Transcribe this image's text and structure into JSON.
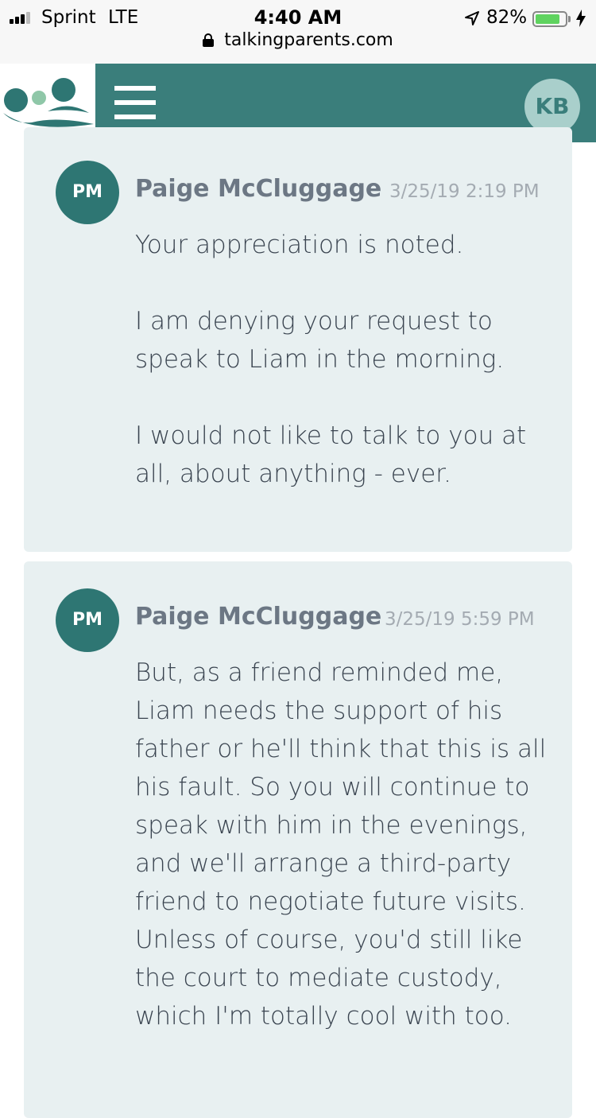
{
  "status_bar": {
    "carrier": "Sprint",
    "network": "LTE",
    "time": "4:40 AM",
    "battery_percent": "82%",
    "battery_level": 0.82,
    "url": "talkingparents.com"
  },
  "header": {
    "user_initials": "KB",
    "logo_icon": "talkingparents-logo",
    "menu_icon": "hamburger-menu-icon"
  },
  "messages": [
    {
      "initials": "PM",
      "sender": "Paige McCluggage",
      "timestamp": "3/25/19 2:19 PM",
      "body": "Your appreciation is noted.\n\nI am denying your request to speak to Liam in the morning.\n\nI would not like to talk to you at all, about anything - ever."
    },
    {
      "initials": "PM",
      "sender": "Paige McCluggage",
      "timestamp": "3/25/19 5:59 PM",
      "body": "But, as a friend reminded me, Liam needs the support of his father or he'll think that this is all his fault. So you will continue to speak with him in the evenings, and we'll arrange a third-party friend to negotiate future visits. Unless of course, you'd still like the court to mediate custody, which I'm totally cool with too."
    }
  ],
  "colors": {
    "brand": "#3a7e7b",
    "card_bg": "#e8f0f1",
    "avatar_bg": "#2e7673"
  }
}
